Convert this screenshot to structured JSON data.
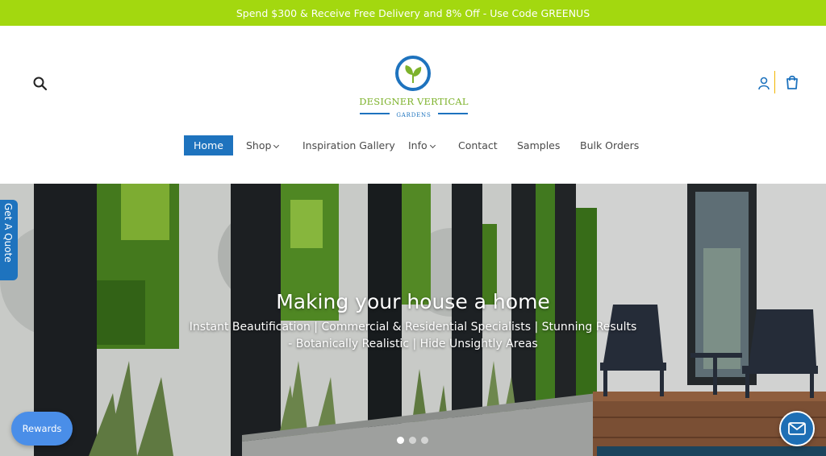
{
  "announcement": {
    "text": "Spend $300 & Receive Free Delivery and 8% Off - Use Code GREENUS"
  },
  "header": {
    "logo": {
      "line1": "DESIGNER VERTICAL",
      "line2": "GARDENS"
    },
    "icons": {
      "search": "search-icon",
      "account": "user-icon",
      "cart": "shopping-bag-icon"
    }
  },
  "nav": {
    "items": [
      {
        "label": "Home",
        "active": true
      },
      {
        "label": "Shop",
        "dropdown": true
      },
      {
        "label": "Inspiration Gallery"
      },
      {
        "label": "Info",
        "dropdown": true
      },
      {
        "label": "Contact"
      },
      {
        "label": "Samples"
      },
      {
        "label": "Bulk Orders"
      }
    ]
  },
  "hero": {
    "title": "Making your house a home",
    "subtitle": "Instant Beautification | Commercial & Residential Specialists | Stunning Results - Botanically Realistic | Hide Unsightly Areas",
    "slides": 3,
    "active_slide": 1
  },
  "widgets": {
    "quote_tab": "Get A Quote",
    "rewards": "Rewards",
    "chat_icon": "mail-icon"
  },
  "colors": {
    "accent": "#a3d80f",
    "brand_blue": "#1e73be"
  }
}
